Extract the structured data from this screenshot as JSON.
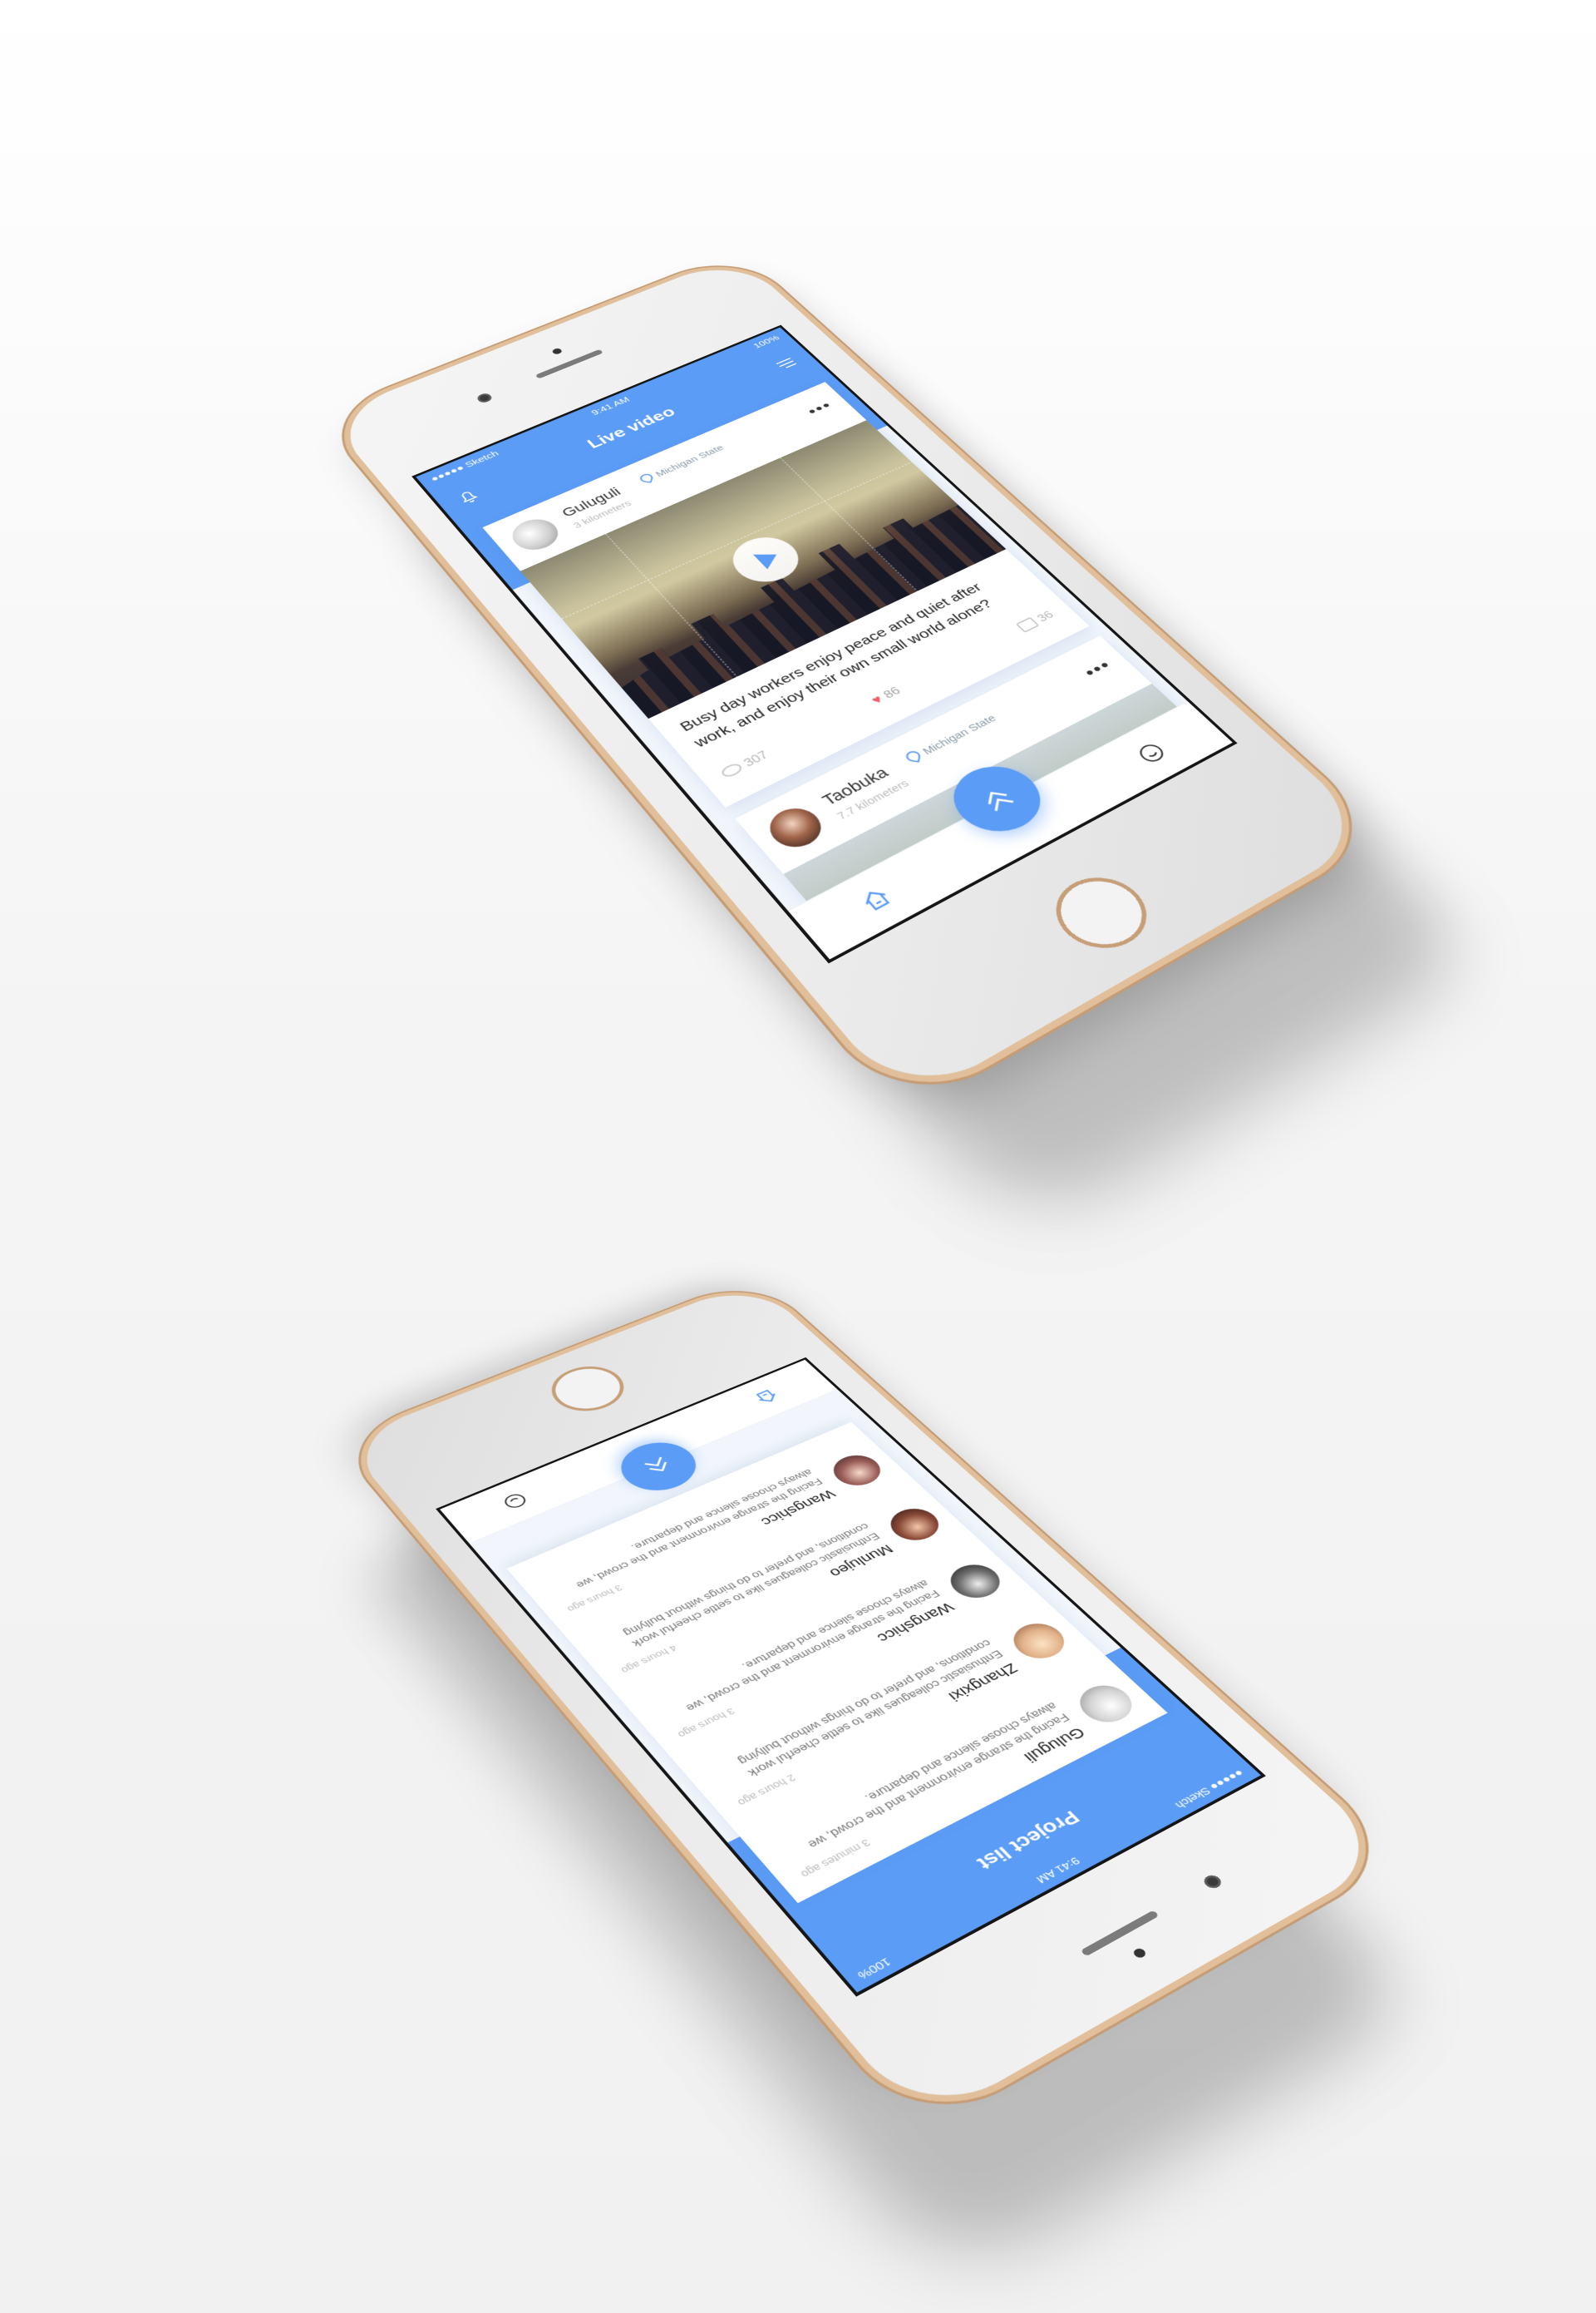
{
  "colors": {
    "accent": "#5b9cf6",
    "gold": "#e0bf9a",
    "like": "#f25c6b"
  },
  "phone1": {
    "status": {
      "carrier": "●●●●● Sketch",
      "time": "9:41 AM",
      "battery": "100%"
    },
    "nav": {
      "title": "Live video",
      "left_icon": "bell-icon",
      "right_icon": "menu-icon"
    },
    "posts": [
      {
        "author": "Guluguli",
        "distance": "3 kilometers",
        "location": "Michigan State",
        "caption": "Busy day workers enjoy peace and quiet after work, and enjoy their own small world alone?",
        "views": "307",
        "likes": "86",
        "comments": "36"
      },
      {
        "author": "Taobuka",
        "distance": "7.7 kilometers",
        "location": "Michigan State"
      }
    ],
    "tabbar": {
      "left_icon": "home-icon",
      "fab_icon": "double-chevron-up-icon",
      "right_icon": "chat-icon"
    }
  },
  "phone2": {
    "status": {
      "carrier": "●●●●● Sketch",
      "time": "9:41 AM",
      "battery": "100%"
    },
    "nav": {
      "title": "Project list"
    },
    "items": [
      {
        "name": "Guluguli",
        "time": "3 minutes ago",
        "text": "Facing the strange environment and the crowd, we always choose silence and departure."
      },
      {
        "name": "Zhangxixi",
        "time": "2 hours ago",
        "text": "Enthusiastic colleagues like to settle cheerful work conditions, and prefer to do things without bullying"
      },
      {
        "name": "Wangshicc",
        "time": "3 hours ago",
        "text": "Facing the strange environment and the crowd, we always choose silence and departure."
      },
      {
        "name": "Munlujeo",
        "time": "4 hours ago",
        "text": "Enthusiastic colleagues like to settle cheerful work conditions, and prefer to do things without bullying"
      },
      {
        "name": "Wangshicc",
        "time": "3 hours ago",
        "text": "Facing the strange environment and the crowd, we always choose silence and departure."
      }
    ]
  }
}
